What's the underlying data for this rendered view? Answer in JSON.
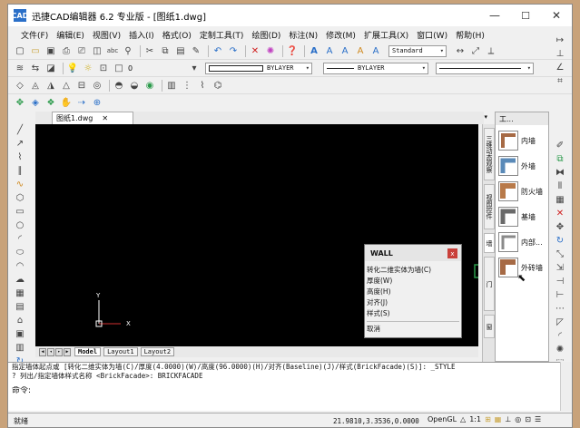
{
  "titlebar": {
    "app_icon": "CAD",
    "title": "迅捷CAD编辑器 6.2 专业版  - [图纸1.dwg]",
    "minimize": "—",
    "maximize": "☐",
    "close": "✕"
  },
  "menu": [
    "文件(F)",
    "编辑(E)",
    "视图(V)",
    "插入(I)",
    "格式(O)",
    "定制工具(T)",
    "绘图(D)",
    "标注(N)",
    "修改(M)",
    "扩展工具(X)",
    "窗口(W)",
    "帮助(H)"
  ],
  "toolbar": {
    "text_style": "Standard",
    "layer": "0",
    "color": "BYLAYER",
    "linetype": "BYLAYER"
  },
  "document": {
    "tab_label": "图纸1.dwg",
    "tab_close": "✕",
    "layouts": [
      "Model",
      "Layout1",
      "Layout2"
    ]
  },
  "canvas": {
    "ucs_x": "X",
    "ucs_y": "Y"
  },
  "wall_popup": {
    "title": "WALL",
    "close": "x",
    "options": [
      "转化二维实体为墙(C)",
      "厚度(W)",
      "高度(H)",
      "对齐(J)",
      "样式(S)"
    ],
    "cancel": "取消"
  },
  "vertical_tabs": [
    "三维动态观察",
    "视图控件",
    "墙",
    "门",
    "窗"
  ],
  "palette": {
    "header": "工...",
    "items": [
      "内墙",
      "外墙",
      "防火墙",
      "基墙",
      "内部...",
      "外砖墙"
    ]
  },
  "command": {
    "line1": "指定墙体起点或 [转化二维实体为墙(C)/厚度(4.0000)(W)/高度(96.0000)(H)/对齐(Baseline)(J)/样式(BrickFacade)(S)]: _STYLE",
    "line2": "? 列出/指定墙体样式名称 <BrickFacade>: BRICKFACADE",
    "prompt": "命令:"
  },
  "status": {
    "left": "就绪",
    "coords": "21.9810,3.3536,0.0000",
    "opengl": "OpenGL",
    "scale": "1:1"
  },
  "colors": {
    "canvas_bg": "#000000",
    "accent_blue": "#2a6fc8",
    "wall_brown": "#a66a45",
    "popup_close": "#c9403a"
  }
}
